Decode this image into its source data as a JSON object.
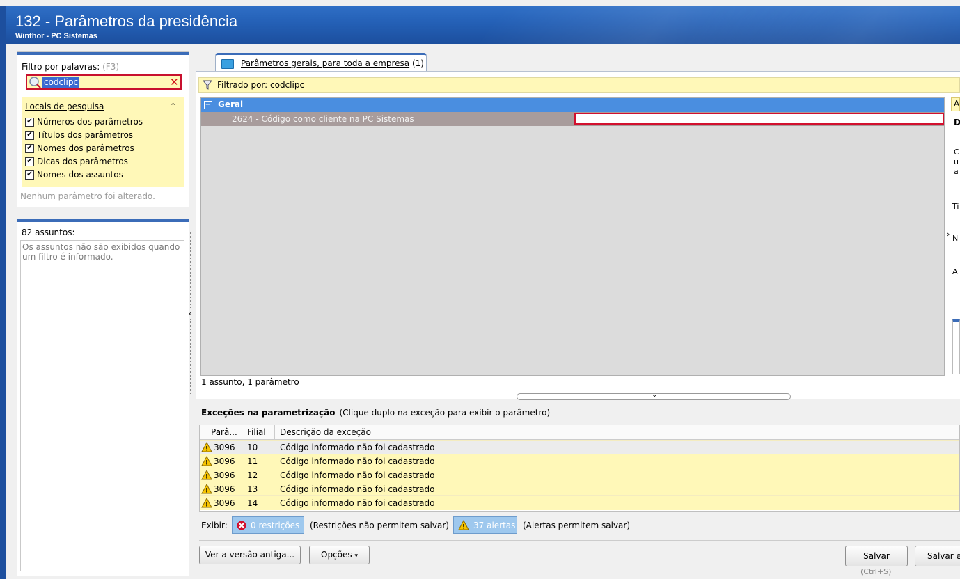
{
  "window": {
    "title": "132 - Parâmetros da presidência",
    "subtitle": "Winthor - PC Sistemas"
  },
  "filter": {
    "label": "Filtro por palavras:",
    "shortcut": "(F3)",
    "search_value": "codclipc",
    "locations_title": "Locais de pesquisa",
    "locations": [
      {
        "label": "Números dos parâmetros",
        "checked": true
      },
      {
        "label": "Títulos dos parâmetros",
        "checked": true
      },
      {
        "label": "Nomes dos parâmetros",
        "checked": true
      },
      {
        "label": "Dicas dos parâmetros",
        "checked": true
      },
      {
        "label": "Nomes dos assuntos",
        "checked": true
      }
    ],
    "status": "Nenhum parâmetro foi alterado."
  },
  "subjects": {
    "title": "82 assuntos:",
    "message": "Os assuntos não são exibidos quando um filtro é informado."
  },
  "tab": {
    "label": "Parâmetros gerais, para toda a empresa",
    "count": "(1)"
  },
  "filterbar": {
    "text": "Filtrado por: codclipc"
  },
  "grid": {
    "group": "Geral",
    "param": "2624 - Código como cliente na PC Sistemas",
    "count_text": "1 assunto, 1 parâmetro"
  },
  "exceptions": {
    "title": "Exceções na parametrização",
    "hint": "(Clique duplo na exceção para exibir o parâmetro)",
    "columns": [
      "Parâ...",
      "Filial",
      "Descrição da exceção"
    ],
    "rows": [
      {
        "param": "3096",
        "filial": "10",
        "desc": "Código informado não foi cadastrado"
      },
      {
        "param": "3096",
        "filial": "11",
        "desc": "Código informado não foi cadastrado"
      },
      {
        "param": "3096",
        "filial": "12",
        "desc": "Código informado não foi cadastrado"
      },
      {
        "param": "3096",
        "filial": "13",
        "desc": "Código informado não foi cadastrado"
      },
      {
        "param": "3096",
        "filial": "14",
        "desc": "Código informado não foi cadastrado"
      }
    ],
    "show_label": "Exibir:",
    "restrictions_label": "0 restrições",
    "restrictions_note": "(Restrições não permitem salvar)",
    "alerts_label": "37 alertas",
    "alerts_note": "(Alertas permitem salvar)"
  },
  "buttons": {
    "old_version": "Ver a versão antiga...",
    "options": "Opções",
    "save": "Salvar",
    "save_shortcut": "(Ctrl+S)",
    "save_as": "Salvar e"
  },
  "right_panel": {
    "letters": [
      "A",
      "D",
      "C",
      "u",
      "a",
      "Ti",
      "N",
      "A"
    ]
  },
  "colors": {
    "titlebar": "#2460b6",
    "highlight_yellow": "#fff8b8",
    "group_blue": "#4a8ee0",
    "error_red": "#d2102e"
  }
}
